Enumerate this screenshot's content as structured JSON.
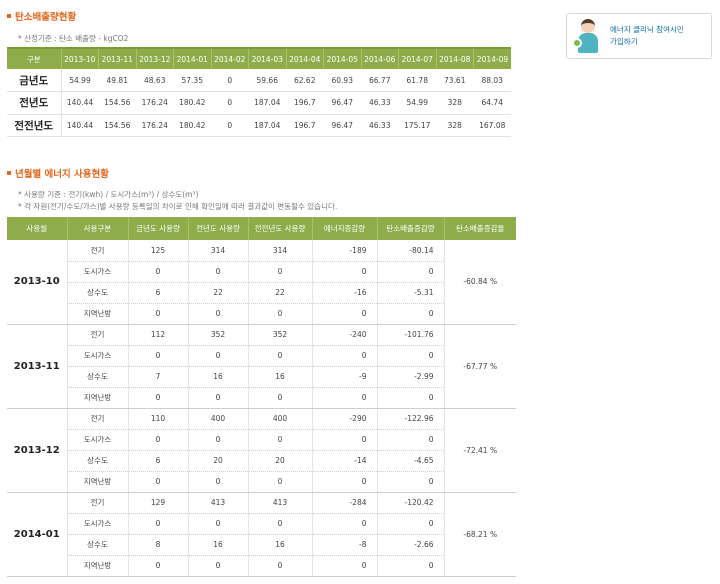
{
  "section1": {
    "title": "탄소배출량현황",
    "note": "* 산정기준 : 탄소 배출량 - kgCO2",
    "header": [
      "구분",
      "2013-10",
      "2013-11",
      "2013-12",
      "2014-01",
      "2014-02",
      "2014-03",
      "2014-04",
      "2014-05",
      "2014-06",
      "2014-07",
      "2014-08",
      "2014-09"
    ],
    "rows": [
      {
        "label": "금년도",
        "values": [
          "54.99",
          "49.81",
          "48.63",
          "57.35",
          "0",
          "59.66",
          "62.62",
          "60.93",
          "66.77",
          "61.78",
          "73.61",
          "88.03"
        ]
      },
      {
        "label": "전년도",
        "values": [
          "140.44",
          "154.56",
          "176.24",
          "180.42",
          "0",
          "187.04",
          "196.7",
          "96.47",
          "46.33",
          "54.99",
          "328",
          "64.74"
        ]
      },
      {
        "label": "전전년도",
        "values": [
          "140.44",
          "154.56",
          "176.24",
          "180.42",
          "0",
          "187.04",
          "196.7",
          "96.47",
          "46.33",
          "175.17",
          "328",
          "167.08"
        ]
      }
    ]
  },
  "section2": {
    "title": "년월별 에너지 사용현황",
    "note1": "* 사용량 기준 : 전기(kwh) / 도시가스(m³) / 상수도(m³)",
    "note2": "* 각 자원(전기/수도/가스)별 사용량 등록일의 차이로 인해 확인일에 따라 결과값이 변동될수 있습니다.",
    "header": [
      "사용월",
      "사용구분",
      "금년도 사용량",
      "전년도 사용량",
      "전전년도 사용량",
      "에너지증감량",
      "탄소배출증감량",
      "탄소배출증감율"
    ],
    "months": [
      {
        "month": "2013-10",
        "rate": "-60.84 %",
        "rows": [
          [
            "전기",
            "125",
            "314",
            "314",
            "-189",
            "-80.14"
          ],
          [
            "도시가스",
            "0",
            "0",
            "0",
            "0",
            "0"
          ],
          [
            "상수도",
            "6",
            "22",
            "22",
            "-16",
            "-5.31"
          ],
          [
            "지역난방",
            "0",
            "0",
            "0",
            "0",
            "0"
          ]
        ]
      },
      {
        "month": "2013-11",
        "rate": "-67.77 %",
        "rows": [
          [
            "전기",
            "112",
            "352",
            "352",
            "-240",
            "-101.76"
          ],
          [
            "도시가스",
            "0",
            "0",
            "0",
            "0",
            "0"
          ],
          [
            "상수도",
            "7",
            "16",
            "16",
            "-9",
            "-2.99"
          ],
          [
            "지역난방",
            "0",
            "0",
            "0",
            "0",
            "0"
          ]
        ]
      },
      {
        "month": "2013-12",
        "rate": "-72.41 %",
        "rows": [
          [
            "전기",
            "110",
            "400",
            "400",
            "-290",
            "-122.96"
          ],
          [
            "도시가스",
            "0",
            "0",
            "0",
            "0",
            "0"
          ],
          [
            "상수도",
            "6",
            "20",
            "20",
            "-14",
            "-4.65"
          ],
          [
            "지역난방",
            "0",
            "0",
            "0",
            "0",
            "0"
          ]
        ]
      },
      {
        "month": "2014-01",
        "rate": "-68.21 %",
        "rows": [
          [
            "전기",
            "129",
            "413",
            "413",
            "-284",
            "-120.42"
          ],
          [
            "도시가스",
            "0",
            "0",
            "0",
            "0",
            "0"
          ],
          [
            "상수도",
            "8",
            "16",
            "16",
            "-8",
            "-2.66"
          ],
          [
            "지역난방",
            "0",
            "0",
            "0",
            "0",
            "0"
          ]
        ]
      }
    ]
  },
  "banner": {
    "line1": "에너지 클리닉 참여시민",
    "line2": "가입하기"
  },
  "colors": {
    "accent": "#e0671c",
    "header_green": "#8fac4b",
    "link_blue": "#0a6eb0"
  }
}
